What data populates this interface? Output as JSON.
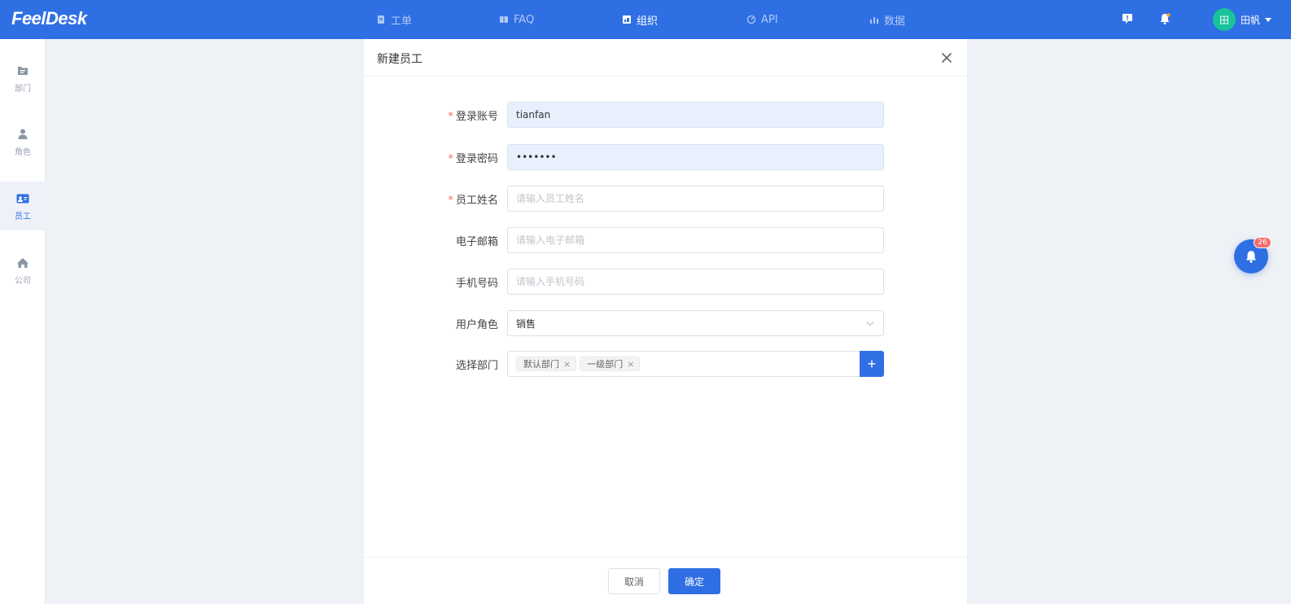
{
  "app": {
    "logo": "FeelDesk"
  },
  "nav": [
    {
      "label": "工单",
      "icon": "ticket-icon",
      "active": false
    },
    {
      "label": "FAQ",
      "icon": "book-icon",
      "active": false
    },
    {
      "label": "组织",
      "icon": "org-icon",
      "active": true
    },
    {
      "label": "API",
      "icon": "api-icon",
      "active": false
    },
    {
      "label": "数据",
      "icon": "chart-icon",
      "active": false
    }
  ],
  "topbar": {
    "user_avatar": "田",
    "user_name": "田帆"
  },
  "sidebar": [
    {
      "label": "部门",
      "icon": "folder-icon",
      "active": false
    },
    {
      "label": "角色",
      "icon": "user-icon",
      "active": false
    },
    {
      "label": "员工",
      "icon": "id-card-icon",
      "active": true
    },
    {
      "label": "公司",
      "icon": "home-icon",
      "active": false
    }
  ],
  "dialog": {
    "title": "新建员工",
    "fields": {
      "account": {
        "label": "登录账号",
        "value": "tianfan",
        "required": true
      },
      "password": {
        "label": "登录密码",
        "value": "•••••••",
        "required": true
      },
      "name": {
        "label": "员工姓名",
        "placeholder": "请输入员工姓名",
        "required": true
      },
      "email": {
        "label": "电子邮箱",
        "placeholder": "请输入电子邮箱"
      },
      "phone": {
        "label": "手机号码",
        "placeholder": "请输入手机号码"
      },
      "role": {
        "label": "用户角色",
        "value": "销售"
      },
      "department": {
        "label": "选择部门",
        "tags": [
          "默认部门",
          "一级部门"
        ],
        "add_label": "+"
      }
    },
    "cancel_label": "取消",
    "ok_label": "确定"
  },
  "notification": {
    "count": "26"
  },
  "colors": {
    "primary": "#2f6fe4",
    "required": "#f56c6c",
    "avatar": "#19c39a"
  }
}
